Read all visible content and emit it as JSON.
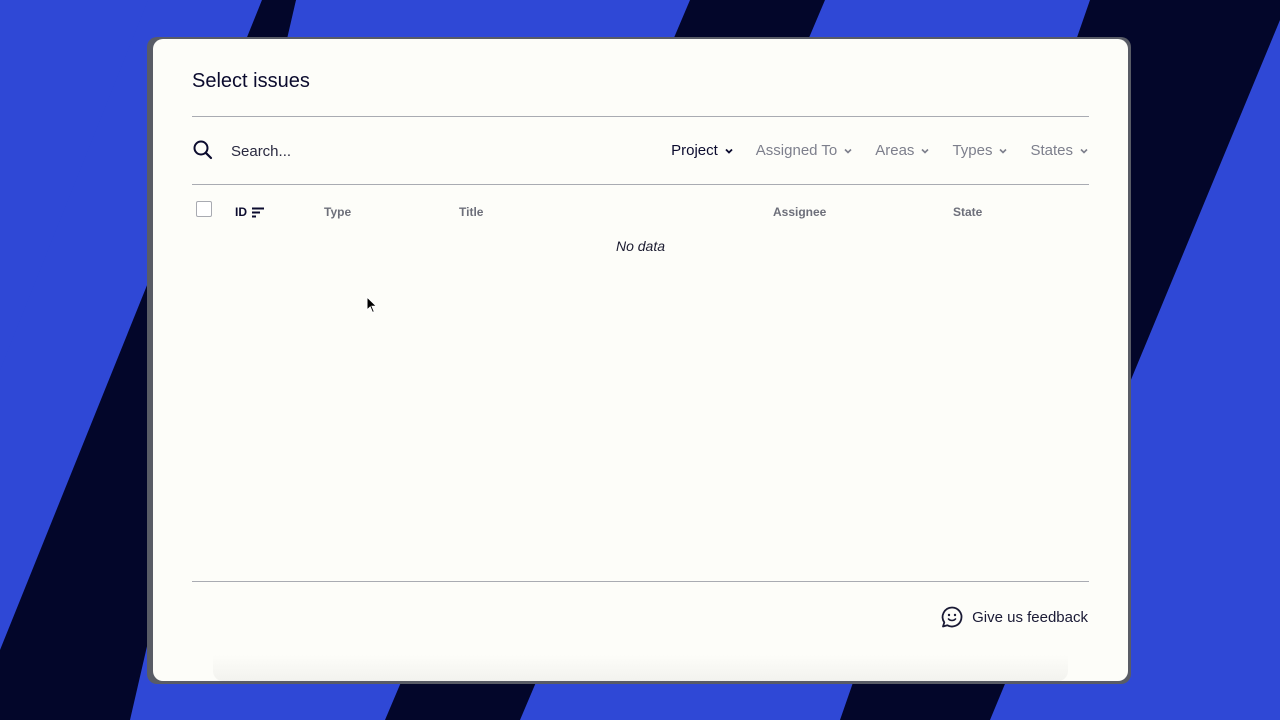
{
  "colors": {
    "background_blue": "#2f48d6",
    "background_navy": "#03062a",
    "modal_bg": "#fdfdf9",
    "text_primary": "#0b0b2e",
    "text_muted": "#7d7f8c"
  },
  "modal": {
    "title": "Select issues"
  },
  "search": {
    "placeholder": "Search...",
    "value": "",
    "icon": "search-icon"
  },
  "filters": [
    {
      "label": "Project",
      "active": true
    },
    {
      "label": "Assigned To",
      "active": false
    },
    {
      "label": "Areas",
      "active": false
    },
    {
      "label": "Types",
      "active": false
    },
    {
      "label": "States",
      "active": false
    }
  ],
  "table": {
    "columns": {
      "id": "ID",
      "type": "Type",
      "title": "Title",
      "assignee": "Assignee",
      "state": "State"
    },
    "empty_text": "No data",
    "select_all_checked": false
  },
  "footer": {
    "feedback_label": "Give us feedback",
    "feedback_icon": "chat-smile-icon"
  }
}
